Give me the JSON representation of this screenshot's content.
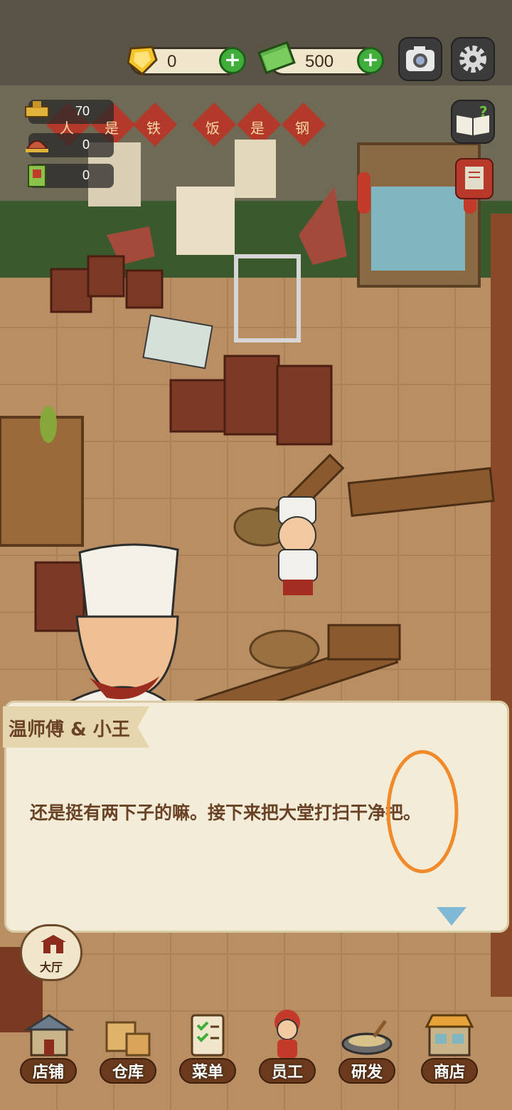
{
  "top_bar": {
    "gems": "0",
    "cash": "500",
    "plus": "+"
  },
  "stats": {
    "reputation": "70",
    "dishes": "0",
    "recipes": "0"
  },
  "banners": [
    "人",
    "是",
    "铁",
    "饭",
    "是",
    "钢"
  ],
  "hall_button": "大厅",
  "dialog": {
    "speaker": "温师傅 & 小王",
    "text": "还是挺有两下子的嘛。接下来把大堂打扫干净把。"
  },
  "nav": {
    "items": [
      {
        "label": "店铺",
        "icon": "shop-icon"
      },
      {
        "label": "仓库",
        "icon": "warehouse-icon"
      },
      {
        "label": "菜单",
        "icon": "menu-icon"
      },
      {
        "label": "员工",
        "icon": "staff-icon"
      },
      {
        "label": "研发",
        "icon": "research-icon"
      },
      {
        "label": "商店",
        "icon": "store-icon"
      }
    ]
  },
  "colors": {
    "floor": "#b98e63",
    "wall": "#5f5a46",
    "dialog_bg": "#f3ecd8",
    "accent_green": "#3fae3a",
    "annotation": "#f08a2a"
  }
}
